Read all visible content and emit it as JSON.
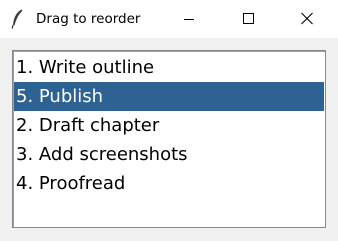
{
  "window": {
    "title": "Drag to reorder",
    "app_icon": "feather-icon",
    "controls": {
      "minimize_icon": "minimize-icon",
      "maximize_icon": "maximize-icon",
      "close_icon": "close-icon"
    }
  },
  "listbox": {
    "items": [
      {
        "label": "1. Write outline",
        "selected": false
      },
      {
        "label": "5. Publish",
        "selected": true
      },
      {
        "label": "2. Draft chapter",
        "selected": false
      },
      {
        "label": "3. Add screenshots",
        "selected": false
      },
      {
        "label": "4. Proofread",
        "selected": false
      }
    ],
    "selection_color": "#2d6293"
  }
}
